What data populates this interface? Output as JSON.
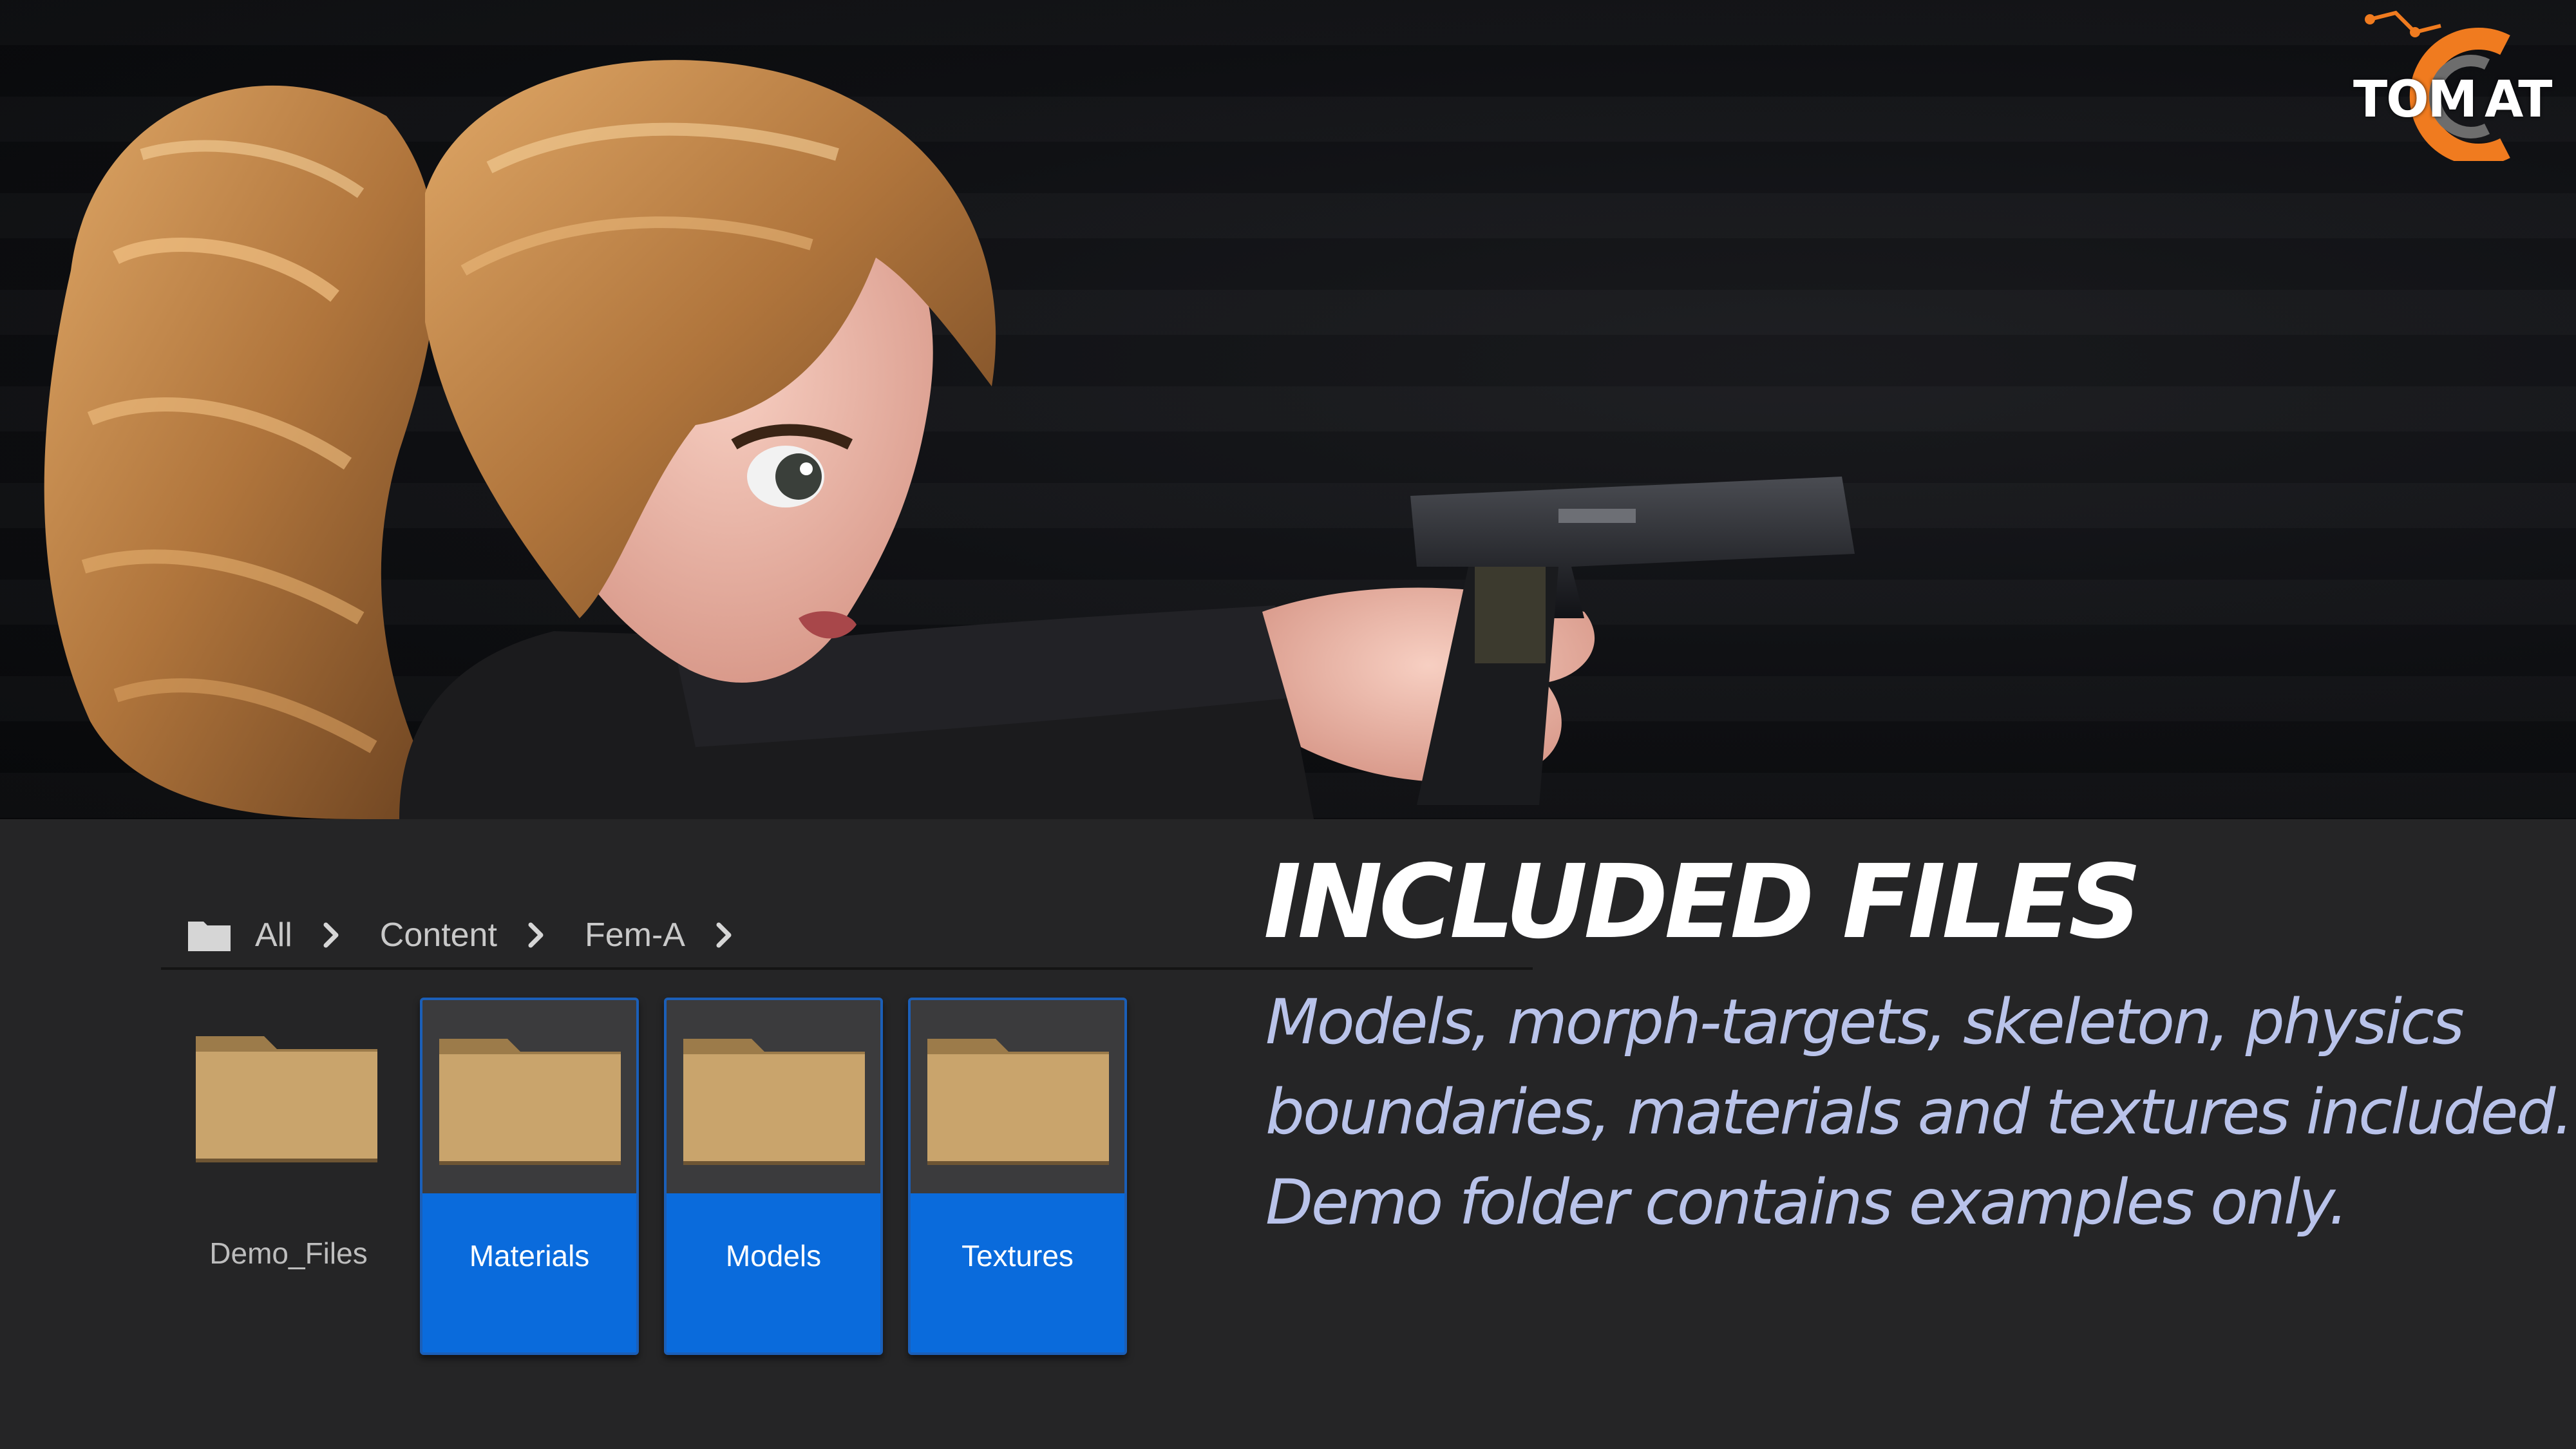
{
  "logo": {
    "text_left": "TOM",
    "text_right": "AT",
    "brand_color": "#f07b1f"
  },
  "breadcrumb": {
    "items": [
      "All",
      "Content",
      "Fem-A"
    ]
  },
  "folders": [
    {
      "label": "Demo_Files",
      "selected": false
    },
    {
      "label": "Materials",
      "selected": true
    },
    {
      "label": "Models",
      "selected": true
    },
    {
      "label": "Textures",
      "selected": true
    }
  ],
  "headline": "INCLUDED FILES",
  "description": {
    "line1": "Models, morph-targets, skeleton, physics",
    "line2": "boundaries, materials and textures included.",
    "line3": "Demo folder contains examples only."
  },
  "colors": {
    "panel_bg": "#252526",
    "selection_blue": "#0a6bdc",
    "folder_tan": "#c9a46c",
    "description_text": "#b9c3ea"
  }
}
